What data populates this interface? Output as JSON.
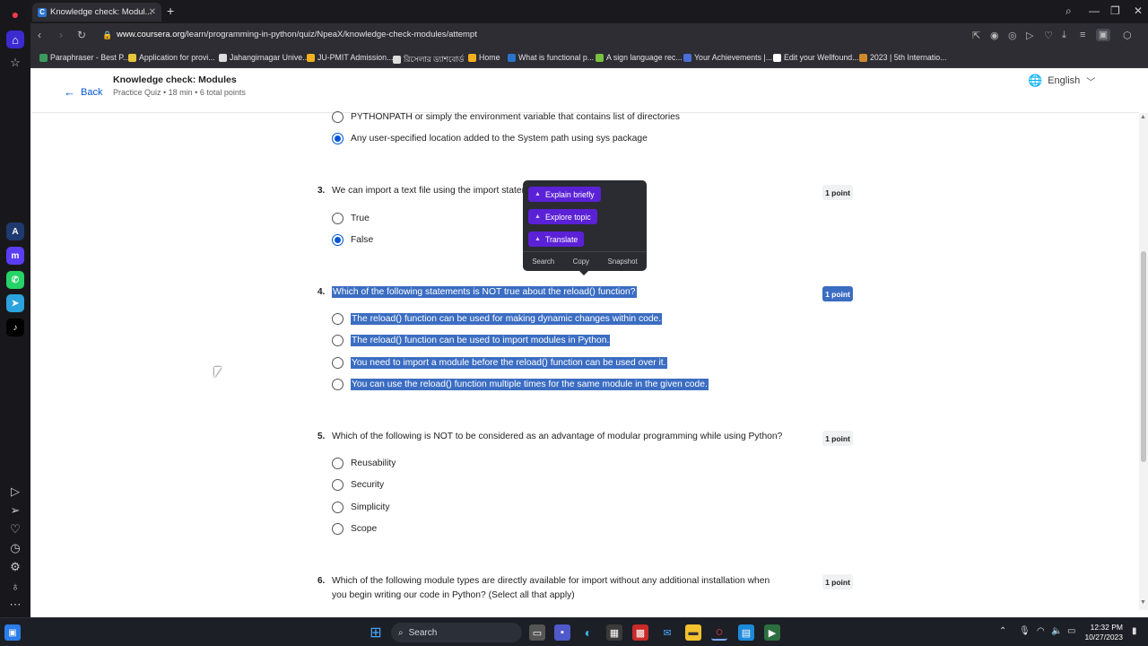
{
  "browser": {
    "tab_title": "Knowledge check: Modul...",
    "url_domain": "www.coursera.org",
    "url_path": "/learn/programming-in-python/quiz/NpeaX/knowledge-check-modules/attempt"
  },
  "bookmarks": [
    "Paraphraser - Best P...",
    "Application for provi...",
    "Jahangirnagar Unive...",
    "JU-PMIT Admission...",
    "রিসেলার ড্যাশবোর্ড",
    "Home",
    "What is functional p...",
    "A sign language rec...",
    "Your Achievements |...",
    "Edit your Wellfound...",
    "2023 | 5th Internatio..."
  ],
  "header": {
    "back_label": "Back",
    "quiz_title": "Knowledge check: Modules",
    "quiz_meta": "Practice Quiz • 18 min • 6 total points",
    "language": "English"
  },
  "q2": {
    "options": [
      "PYTHONPATH or simply the environment variable that contains list of directories",
      "Any user-specified location added to the System path using sys package"
    ],
    "selected": 1
  },
  "q3": {
    "num": "3.",
    "text": "We can import a text file using the import statem",
    "points": "1 point",
    "options": [
      "True",
      "False"
    ],
    "selected": 1
  },
  "q4": {
    "num": "4.",
    "text": "Which of the following statements is NOT true about the reload() function?",
    "points": "1 point",
    "options": [
      "The reload() function can be used for making dynamic changes within code.",
      "The reload() function can be used to import modules in Python.",
      "You need to import a module before the reload() function can be used over it.",
      "You can use the reload() function multiple times for the same module in the given code."
    ]
  },
  "q5": {
    "num": "5.",
    "text": "Which of the following is NOT to be considered as an advantage of modular programming while using Python?",
    "points": "1 point",
    "options": [
      "Reusability",
      "Security",
      "Simplicity",
      "Scope"
    ]
  },
  "q6": {
    "num": "6.",
    "text_line1": "Which of the following module types are directly available for import without any additional installation when",
    "text_line2": "you begin writing our code in Python? (Select all that apply)",
    "points": "1 point"
  },
  "popup": {
    "actions": [
      "Explain briefly",
      "Explore topic",
      "Translate"
    ],
    "footer": [
      "Search",
      "Copy",
      "Snapshot"
    ]
  },
  "taskbar": {
    "search_label": "Search",
    "time": "12:32 PM",
    "date": "10/27/2023"
  },
  "colors": {
    "accent": "#0056d2",
    "selection": "#3b6dc2",
    "popup_button": "#5b21d6"
  }
}
